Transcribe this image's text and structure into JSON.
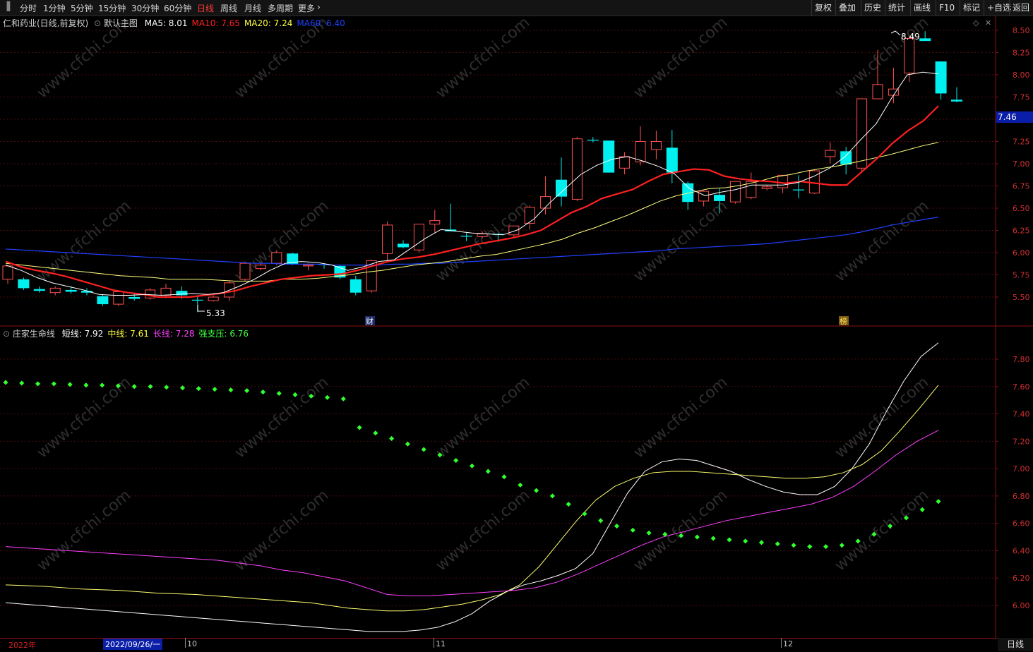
{
  "toolbar": {
    "periods": [
      "分时",
      "1分钟",
      "5分钟",
      "15分钟",
      "30分钟",
      "60分钟",
      "日线",
      "周线",
      "月线",
      "多周期",
      "更多"
    ],
    "active_period": "日线",
    "right_buttons": [
      "复权",
      "叠加",
      "历史",
      "统计",
      "画线",
      "F10",
      "标记",
      "+自选",
      "返回"
    ]
  },
  "main_chart": {
    "title": "仁和药业(日线,前复权)",
    "indicator_name": "默认主图",
    "ma": [
      {
        "label": "MA5:",
        "value": "8.01",
        "color": "#ffffff"
      },
      {
        "label": "MA10:",
        "value": "7.65",
        "color": "#ff2020"
      },
      {
        "label": "MA20:",
        "value": "7.24",
        "color": "#ffff40"
      },
      {
        "label": "MA60:",
        "value": "6.40",
        "color": "#2040ff"
      }
    ],
    "price_axis": [
      "8.50",
      "8.25",
      "8.00",
      "7.75",
      "7.50",
      "7.25",
      "7.00",
      "6.75",
      "6.50",
      "6.25",
      "6.00",
      "5.75",
      "5.50"
    ],
    "last_price": "7.46",
    "high_marker": "8.49",
    "low_marker": "5.33",
    "event_markers": [
      "财",
      "榜"
    ]
  },
  "sub_chart": {
    "indicator_name": "庄家生命线",
    "lines": [
      {
        "label": "短线:",
        "value": "7.92",
        "color": "#ffffff"
      },
      {
        "label": "中线:",
        "value": "7.61",
        "color": "#ffff40"
      },
      {
        "label": "长线:",
        "value": "7.28",
        "color": "#ff40ff"
      },
      {
        "label": "强支压:",
        "value": "6.76",
        "color": "#40ff40"
      }
    ],
    "value_axis": [
      "7.80",
      "7.60",
      "7.40",
      "7.20",
      "7.00",
      "6.80",
      "6.60",
      "6.40",
      "6.20",
      "6.00"
    ]
  },
  "date_axis": {
    "year_label": "2022年",
    "cursor_date": "2022/09/26/一",
    "month_labels": [
      "10",
      "11",
      "12"
    ]
  },
  "period_label": "日线",
  "watermark": "www.cfchi.com",
  "chart_data": [
    {
      "type": "candlestick",
      "yrange": [
        5.3,
        8.6
      ],
      "candles": [
        [
          5.7,
          5.85,
          5.65,
          5.85
        ],
        [
          5.7,
          5.72,
          5.58,
          5.6
        ],
        [
          5.59,
          5.62,
          5.55,
          5.57
        ],
        [
          5.55,
          5.62,
          5.52,
          5.6
        ],
        [
          5.58,
          5.62,
          5.54,
          5.56
        ],
        [
          5.57,
          5.6,
          5.52,
          5.55
        ],
        [
          5.51,
          5.53,
          5.4,
          5.42
        ],
        [
          5.42,
          5.56,
          5.4,
          5.56
        ],
        [
          5.5,
          5.55,
          5.46,
          5.48
        ],
        [
          5.49,
          5.6,
          5.47,
          5.58
        ],
        [
          5.52,
          5.65,
          5.49,
          5.6
        ],
        [
          5.57,
          5.62,
          5.48,
          5.52
        ],
        [
          5.47,
          5.52,
          5.33,
          5.46
        ],
        [
          5.46,
          5.52,
          5.45,
          5.5
        ],
        [
          5.5,
          5.68,
          5.46,
          5.66
        ],
        [
          5.7,
          5.9,
          5.68,
          5.88
        ],
        [
          5.82,
          5.88,
          5.8,
          5.86
        ],
        [
          5.88,
          6.02,
          5.86,
          6.0
        ],
        [
          5.99,
          6.0,
          5.86,
          5.87
        ],
        [
          5.85,
          5.88,
          5.8,
          5.86
        ],
        [
          5.87,
          5.88,
          5.82,
          5.86
        ],
        [
          5.85,
          5.86,
          5.7,
          5.72
        ],
        [
          5.7,
          5.74,
          5.52,
          5.55
        ],
        [
          5.57,
          5.92,
          5.55,
          5.91
        ],
        [
          5.99,
          6.35,
          5.9,
          6.31
        ],
        [
          6.1,
          6.14,
          6.05,
          6.06
        ],
        [
          6.03,
          6.32,
          6.0,
          6.32
        ],
        [
          6.32,
          6.48,
          6.22,
          6.36
        ],
        [
          6.26,
          6.55,
          6.24,
          6.24
        ],
        [
          6.19,
          6.22,
          6.13,
          6.18
        ],
        [
          6.18,
          6.24,
          6.16,
          6.21
        ],
        [
          6.21,
          6.22,
          6.12,
          6.2
        ],
        [
          6.2,
          6.3,
          6.17,
          6.3
        ],
        [
          6.33,
          6.53,
          6.26,
          6.51
        ],
        [
          6.5,
          6.86,
          6.43,
          6.63
        ],
        [
          6.82,
          7.07,
          6.52,
          6.63
        ],
        [
          6.6,
          7.3,
          6.58,
          7.28
        ],
        [
          7.27,
          7.3,
          7.24,
          7.26
        ],
        [
          7.26,
          7.25,
          6.9,
          6.9
        ],
        [
          6.95,
          7.13,
          6.88,
          7.08
        ],
        [
          7.02,
          7.42,
          6.98,
          7.25
        ],
        [
          7.16,
          7.37,
          7.05,
          7.25
        ],
        [
          7.18,
          7.38,
          6.78,
          6.9
        ],
        [
          6.78,
          6.8,
          6.48,
          6.57
        ],
        [
          6.58,
          6.7,
          6.52,
          6.69
        ],
        [
          6.65,
          6.72,
          6.44,
          6.58
        ],
        [
          6.57,
          6.74,
          6.55,
          6.8
        ],
        [
          6.62,
          6.9,
          6.6,
          6.8
        ],
        [
          6.72,
          6.76,
          6.7,
          6.74
        ],
        [
          6.73,
          6.84,
          6.67,
          6.87
        ],
        [
          6.71,
          6.87,
          6.61,
          6.7
        ],
        [
          6.67,
          6.93,
          6.66,
          6.92
        ],
        [
          7.08,
          7.24,
          7.0,
          7.15
        ],
        [
          7.14,
          7.19,
          6.88,
          6.99
        ],
        [
          6.95,
          7.73,
          6.92,
          7.73
        ],
        [
          7.73,
          8.28,
          7.76,
          7.89
        ],
        [
          7.77,
          8.08,
          7.68,
          7.84
        ],
        [
          8.02,
          8.44,
          7.92,
          8.41
        ],
        [
          8.41,
          8.49,
          8.38,
          8.38
        ],
        [
          8.15,
          8.15,
          7.72,
          7.79
        ],
        [
          7.72,
          7.86,
          7.69,
          7.7
        ]
      ],
      "ma5": [
        5.86,
        5.8,
        5.72,
        5.66,
        5.62,
        5.58,
        5.53,
        5.52,
        5.52,
        5.53,
        5.52,
        5.53,
        5.54,
        5.53,
        5.55,
        5.62,
        5.7,
        5.8,
        5.88,
        5.9,
        5.89,
        5.86,
        5.8,
        5.84,
        5.9,
        5.92,
        6.04,
        6.16,
        6.26,
        6.24,
        6.22,
        6.21,
        6.2,
        6.26,
        6.38,
        6.56,
        6.72,
        6.88,
        6.98,
        7.05,
        7.08,
        7.03,
        6.97,
        6.89,
        6.72,
        6.64,
        6.68,
        6.71,
        6.76,
        6.76,
        6.76,
        6.79,
        6.86,
        6.95,
        7.08,
        7.27,
        7.45,
        7.74,
        8.0,
        8.03,
        8.01
      ],
      "ma10": [
        5.9,
        5.84,
        5.8,
        5.77,
        5.73,
        5.68,
        5.63,
        5.58,
        5.55,
        5.53,
        5.5,
        5.5,
        5.5,
        5.52,
        5.54,
        5.57,
        5.62,
        5.66,
        5.7,
        5.72,
        5.74,
        5.75,
        5.76,
        5.8,
        5.85,
        5.9,
        5.93,
        5.95,
        5.98,
        6.02,
        6.06,
        6.1,
        6.13,
        6.16,
        6.2,
        6.25,
        6.35,
        6.45,
        6.52,
        6.61,
        6.66,
        6.71,
        6.8,
        6.88,
        6.91,
        6.94,
        6.93,
        6.86,
        6.83,
        6.81,
        6.8,
        6.78,
        6.8,
        6.78,
        6.76,
        6.76,
        6.91,
        7.06,
        7.23,
        7.37,
        7.48,
        7.65
      ],
      "ma20": [
        5.88,
        5.86,
        5.84,
        5.82,
        5.8,
        5.78,
        5.76,
        5.74,
        5.73,
        5.72,
        5.7,
        5.7,
        5.7,
        5.69,
        5.68,
        5.68,
        5.68,
        5.7,
        5.7,
        5.71,
        5.73,
        5.75,
        5.78,
        5.8,
        5.83,
        5.86,
        5.88,
        5.9,
        5.93,
        5.96,
        5.98,
        6.02,
        6.06,
        6.1,
        6.15,
        6.22,
        6.28,
        6.35,
        6.42,
        6.5,
        6.58,
        6.64,
        6.68,
        6.72,
        6.73,
        6.76,
        6.8,
        6.85,
        6.88,
        6.92,
        6.95,
        6.98,
        7.02,
        7.06,
        7.1,
        7.15,
        7.2,
        7.24
      ],
      "ma60": [
        6.04,
        6.03,
        6.02,
        6.01,
        6.0,
        5.99,
        5.98,
        5.97,
        5.96,
        5.95,
        5.94,
        5.93,
        5.92,
        5.91,
        5.9,
        5.89,
        5.88,
        5.88,
        5.87,
        5.87,
        5.87,
        5.86,
        5.86,
        5.86,
        5.86,
        5.87,
        5.87,
        5.88,
        5.88,
        5.89,
        5.9,
        5.91,
        5.92,
        5.93,
        5.94,
        5.95,
        5.96,
        5.97,
        5.98,
        5.99,
        6.0,
        6.01,
        6.02,
        6.04,
        6.05,
        6.06,
        6.07,
        6.08,
        6.09,
        6.1,
        6.12,
        6.14,
        6.16,
        6.18,
        6.2,
        6.23,
        6.27,
        6.31,
        6.34,
        6.37,
        6.4
      ]
    },
    {
      "type": "line",
      "yrange": [
        5.8,
        7.99
      ],
      "series": [
        {
          "name": "短线",
          "values": [
            6.02,
            6.01,
            6.0,
            5.99,
            5.98,
            5.97,
            5.96,
            5.95,
            5.94,
            5.93,
            5.92,
            5.91,
            5.9,
            5.89,
            5.88,
            5.87,
            5.86,
            5.85,
            5.84,
            5.83,
            5.82,
            5.81,
            5.81,
            5.81,
            5.82,
            5.84,
            5.88,
            5.94,
            6.03,
            6.1,
            6.15,
            6.18,
            6.22,
            6.27,
            6.38,
            6.6,
            6.82,
            6.98,
            7.05,
            7.07,
            7.06,
            7.02,
            6.98,
            6.92,
            6.87,
            6.83,
            6.81,
            6.81,
            6.87,
            7.0,
            7.18,
            7.42,
            7.64,
            7.82,
            7.92
          ]
        },
        {
          "name": "中线",
          "values": [
            6.15,
            6.145,
            6.14,
            6.13,
            6.12,
            6.115,
            6.11,
            6.1,
            6.09,
            6.085,
            6.08,
            6.07,
            6.06,
            6.05,
            6.04,
            6.03,
            6.02,
            6.0,
            5.98,
            5.97,
            5.96,
            5.96,
            5.97,
            5.99,
            6.01,
            6.04,
            6.08,
            6.15,
            6.28,
            6.45,
            6.62,
            6.77,
            6.87,
            6.93,
            6.97,
            6.98,
            6.98,
            6.97,
            6.96,
            6.95,
            6.94,
            6.93,
            6.93,
            6.94,
            6.97,
            7.03,
            7.13,
            7.28,
            7.44,
            7.61
          ]
        },
        {
          "name": "长线",
          "values": [
            6.43,
            6.42,
            6.41,
            6.4,
            6.39,
            6.38,
            6.37,
            6.36,
            6.35,
            6.34,
            6.33,
            6.31,
            6.29,
            6.26,
            6.24,
            6.21,
            6.18,
            6.13,
            6.08,
            6.07,
            6.07,
            6.08,
            6.09,
            6.1,
            6.11,
            6.13,
            6.17,
            6.23,
            6.3,
            6.37,
            6.44,
            6.5,
            6.54,
            6.58,
            6.62,
            6.65,
            6.68,
            6.71,
            6.74,
            6.79,
            6.87,
            6.98,
            7.1,
            7.2,
            7.28
          ]
        },
        {
          "name": "强支压",
          "values": [
            7.63,
            7.625,
            7.62,
            7.62,
            7.615,
            7.61,
            7.61,
            7.605,
            7.6,
            7.6,
            7.595,
            7.59,
            7.585,
            7.58,
            7.575,
            7.57,
            7.56,
            7.55,
            7.54,
            7.53,
            7.52,
            7.51,
            7.3,
            7.26,
            7.22,
            7.18,
            7.14,
            7.1,
            7.06,
            7.02,
            6.98,
            6.94,
            6.88,
            6.84,
            6.8,
            6.74,
            6.67,
            6.62,
            6.58,
            6.55,
            6.53,
            6.52,
            6.51,
            6.5,
            6.49,
            6.48,
            6.47,
            6.46,
            6.45,
            6.44,
            6.43,
            6.43,
            6.44,
            6.47,
            6.52,
            6.58,
            6.64,
            6.7,
            6.76
          ]
        }
      ]
    }
  ]
}
